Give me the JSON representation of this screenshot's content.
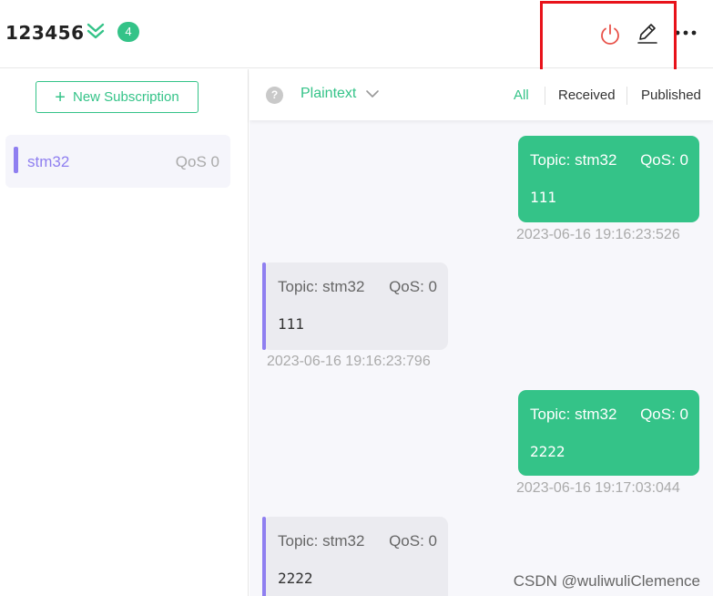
{
  "header": {
    "connection_name": "123456",
    "unread_count": "4"
  },
  "sidebar": {
    "new_subscription_label": "New Subscription",
    "subscriptions": [
      {
        "topic": "stm32",
        "qos": "QoS 0",
        "color": "#8f7ff0"
      }
    ]
  },
  "toolbar": {
    "payload_type": "Plaintext",
    "filters": {
      "all": "All",
      "received": "Received",
      "published": "Published"
    }
  },
  "messages": [
    {
      "direction": "out",
      "topic": "Topic: stm32",
      "qos": "QoS: 0",
      "payload": "111",
      "time": "2023-06-16 19:16:23:526"
    },
    {
      "direction": "in",
      "topic": "Topic: stm32",
      "qos": "QoS: 0",
      "payload": "111",
      "time": "2023-06-16 19:16:23:796"
    },
    {
      "direction": "out",
      "topic": "Topic: stm32",
      "qos": "QoS: 0",
      "payload": "2222",
      "time": "2023-06-16 19:17:03:044"
    },
    {
      "direction": "in",
      "topic": "Topic: stm32",
      "qos": "QoS: 0",
      "payload": "2222",
      "time": ""
    }
  ],
  "watermark": "CSDN @wuliwuliClemence",
  "colors": {
    "accent": "#34c388",
    "subscription": "#8f7ff0",
    "disconnect": "#e8524a",
    "highlight": "#e8121a"
  },
  "icons": [
    "chevron-double-down-icon",
    "power-icon",
    "edit-icon",
    "more-icon",
    "plus-icon",
    "help-icon",
    "chevron-down-icon"
  ]
}
